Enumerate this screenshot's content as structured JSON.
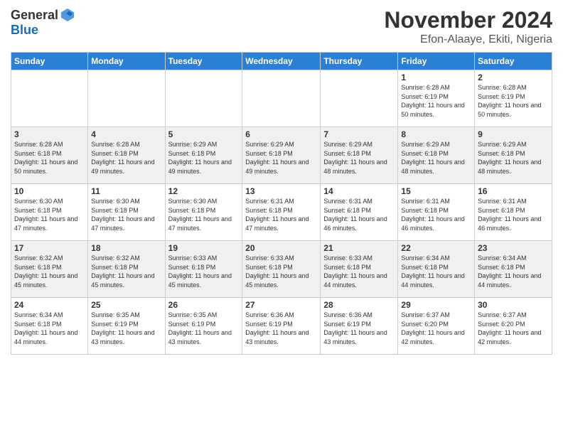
{
  "logo": {
    "general": "General",
    "blue": "Blue"
  },
  "header": {
    "title": "November 2024",
    "subtitle": "Efon-Alaaye, Ekiti, Nigeria"
  },
  "columns": [
    "Sunday",
    "Monday",
    "Tuesday",
    "Wednesday",
    "Thursday",
    "Friday",
    "Saturday"
  ],
  "weeks": [
    [
      {
        "day": "",
        "info": ""
      },
      {
        "day": "",
        "info": ""
      },
      {
        "day": "",
        "info": ""
      },
      {
        "day": "",
        "info": ""
      },
      {
        "day": "",
        "info": ""
      },
      {
        "day": "1",
        "info": "Sunrise: 6:28 AM\nSunset: 6:19 PM\nDaylight: 11 hours and 50 minutes."
      },
      {
        "day": "2",
        "info": "Sunrise: 6:28 AM\nSunset: 6:19 PM\nDaylight: 11 hours and 50 minutes."
      }
    ],
    [
      {
        "day": "3",
        "info": "Sunrise: 6:28 AM\nSunset: 6:18 PM\nDaylight: 11 hours and 50 minutes."
      },
      {
        "day": "4",
        "info": "Sunrise: 6:28 AM\nSunset: 6:18 PM\nDaylight: 11 hours and 49 minutes."
      },
      {
        "day": "5",
        "info": "Sunrise: 6:29 AM\nSunset: 6:18 PM\nDaylight: 11 hours and 49 minutes."
      },
      {
        "day": "6",
        "info": "Sunrise: 6:29 AM\nSunset: 6:18 PM\nDaylight: 11 hours and 49 minutes."
      },
      {
        "day": "7",
        "info": "Sunrise: 6:29 AM\nSunset: 6:18 PM\nDaylight: 11 hours and 48 minutes."
      },
      {
        "day": "8",
        "info": "Sunrise: 6:29 AM\nSunset: 6:18 PM\nDaylight: 11 hours and 48 minutes."
      },
      {
        "day": "9",
        "info": "Sunrise: 6:29 AM\nSunset: 6:18 PM\nDaylight: 11 hours and 48 minutes."
      }
    ],
    [
      {
        "day": "10",
        "info": "Sunrise: 6:30 AM\nSunset: 6:18 PM\nDaylight: 11 hours and 47 minutes."
      },
      {
        "day": "11",
        "info": "Sunrise: 6:30 AM\nSunset: 6:18 PM\nDaylight: 11 hours and 47 minutes."
      },
      {
        "day": "12",
        "info": "Sunrise: 6:30 AM\nSunset: 6:18 PM\nDaylight: 11 hours and 47 minutes."
      },
      {
        "day": "13",
        "info": "Sunrise: 6:31 AM\nSunset: 6:18 PM\nDaylight: 11 hours and 47 minutes."
      },
      {
        "day": "14",
        "info": "Sunrise: 6:31 AM\nSunset: 6:18 PM\nDaylight: 11 hours and 46 minutes."
      },
      {
        "day": "15",
        "info": "Sunrise: 6:31 AM\nSunset: 6:18 PM\nDaylight: 11 hours and 46 minutes."
      },
      {
        "day": "16",
        "info": "Sunrise: 6:31 AM\nSunset: 6:18 PM\nDaylight: 11 hours and 46 minutes."
      }
    ],
    [
      {
        "day": "17",
        "info": "Sunrise: 6:32 AM\nSunset: 6:18 PM\nDaylight: 11 hours and 45 minutes."
      },
      {
        "day": "18",
        "info": "Sunrise: 6:32 AM\nSunset: 6:18 PM\nDaylight: 11 hours and 45 minutes."
      },
      {
        "day": "19",
        "info": "Sunrise: 6:33 AM\nSunset: 6:18 PM\nDaylight: 11 hours and 45 minutes."
      },
      {
        "day": "20",
        "info": "Sunrise: 6:33 AM\nSunset: 6:18 PM\nDaylight: 11 hours and 45 minutes."
      },
      {
        "day": "21",
        "info": "Sunrise: 6:33 AM\nSunset: 6:18 PM\nDaylight: 11 hours and 44 minutes."
      },
      {
        "day": "22",
        "info": "Sunrise: 6:34 AM\nSunset: 6:18 PM\nDaylight: 11 hours and 44 minutes."
      },
      {
        "day": "23",
        "info": "Sunrise: 6:34 AM\nSunset: 6:18 PM\nDaylight: 11 hours and 44 minutes."
      }
    ],
    [
      {
        "day": "24",
        "info": "Sunrise: 6:34 AM\nSunset: 6:18 PM\nDaylight: 11 hours and 44 minutes."
      },
      {
        "day": "25",
        "info": "Sunrise: 6:35 AM\nSunset: 6:19 PM\nDaylight: 11 hours and 43 minutes."
      },
      {
        "day": "26",
        "info": "Sunrise: 6:35 AM\nSunset: 6:19 PM\nDaylight: 11 hours and 43 minutes."
      },
      {
        "day": "27",
        "info": "Sunrise: 6:36 AM\nSunset: 6:19 PM\nDaylight: 11 hours and 43 minutes."
      },
      {
        "day": "28",
        "info": "Sunrise: 6:36 AM\nSunset: 6:19 PM\nDaylight: 11 hours and 43 minutes."
      },
      {
        "day": "29",
        "info": "Sunrise: 6:37 AM\nSunset: 6:20 PM\nDaylight: 11 hours and 42 minutes."
      },
      {
        "day": "30",
        "info": "Sunrise: 6:37 AM\nSunset: 6:20 PM\nDaylight: 11 hours and 42 minutes."
      }
    ]
  ]
}
